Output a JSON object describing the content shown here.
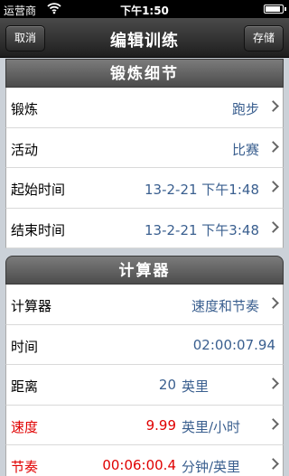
{
  "status_bar": {
    "carrier": "运营商",
    "time": "下午1:50",
    "battery_level": 0.9
  },
  "nav": {
    "title": "编辑训练",
    "cancel_label": "取消",
    "save_label": "存储"
  },
  "sections": {
    "details": {
      "header": "锻炼细节",
      "rows": [
        {
          "label": "锻炼",
          "value": "跑步"
        },
        {
          "label": "活动",
          "value": "比赛"
        },
        {
          "label": "起始时间",
          "value": "13-2-21 下午1:48"
        },
        {
          "label": "结束时间",
          "value": "13-2-21 下午3:48"
        }
      ]
    },
    "calculator": {
      "header": "计算器",
      "rows": [
        {
          "label": "计算器",
          "value": "速度和节奏"
        },
        {
          "label": "时间",
          "value": "02:00:07.94"
        },
        {
          "label": "距离",
          "value": "20",
          "unit": "英里"
        },
        {
          "label": "速度",
          "value": "9.99",
          "unit": "英里/小时"
        },
        {
          "label": "节奏",
          "value": "00:06:00.4",
          "unit": "分钟/英里"
        }
      ]
    }
  },
  "colors": {
    "value_blue": "#3a5f8f",
    "highlight_red": "#e00000"
  }
}
